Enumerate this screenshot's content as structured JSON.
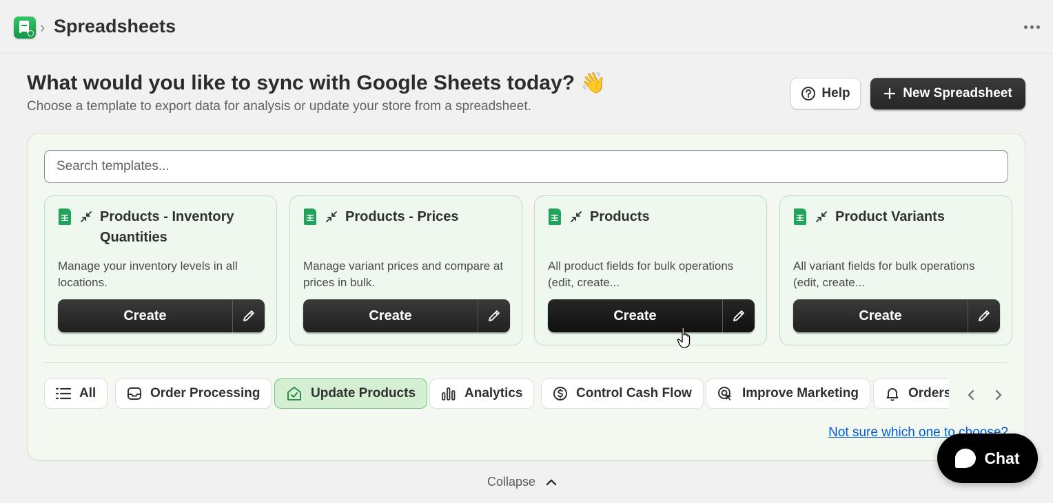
{
  "topbar": {
    "title": "Spreadsheets",
    "app_icon": "google-sheets-app-icon",
    "more_icon": "more-horizontal-icon"
  },
  "header": {
    "headline": "What would you like to sync with Google Sheets today? 👋",
    "subline": "Choose a template to export data for analysis or update your store from a spreadsheet.",
    "help_label": "Help",
    "new_label": "New Spreadsheet"
  },
  "search": {
    "placeholder": "Search templates...",
    "value": ""
  },
  "cards": [
    {
      "title": "Products - Inventory Quantities",
      "description": "Manage your inventory levels in all locations.",
      "create_label": "Create"
    },
    {
      "title": "Products - Prices",
      "description": "Manage variant prices and compare at prices in bulk.",
      "create_label": "Create"
    },
    {
      "title": "Products",
      "description": "All product fields for bulk operations (edit, create...",
      "create_label": "Create"
    },
    {
      "title": "Product Variants",
      "description": "All variant fields for bulk operations (edit, create...",
      "create_label": "Create"
    }
  ],
  "categories": [
    {
      "label": "All",
      "icon": "list-icon",
      "active": false
    },
    {
      "label": "Order Processing",
      "icon": "inbox-icon",
      "active": false
    },
    {
      "label": "Update Products",
      "icon": "tag-check-icon",
      "active": true
    },
    {
      "label": "Analytics",
      "icon": "bar-chart-icon",
      "active": false
    },
    {
      "label": "Control Cash Flow",
      "icon": "dollar-circle-icon",
      "active": false
    },
    {
      "label": "Improve Marketing",
      "icon": "target-cursor-icon",
      "active": false
    },
    {
      "label": "Orders",
      "icon": "bell-icon",
      "active": false
    }
  ],
  "help_link": "Not sure which one to choose?",
  "collapse_label": "Collapse",
  "chat_label": "Chat",
  "colors": {
    "accent_green": "#20a45a",
    "active_chip_bg": "#d4efd2",
    "link_blue": "#005bd3",
    "dark_button": "#262626"
  }
}
